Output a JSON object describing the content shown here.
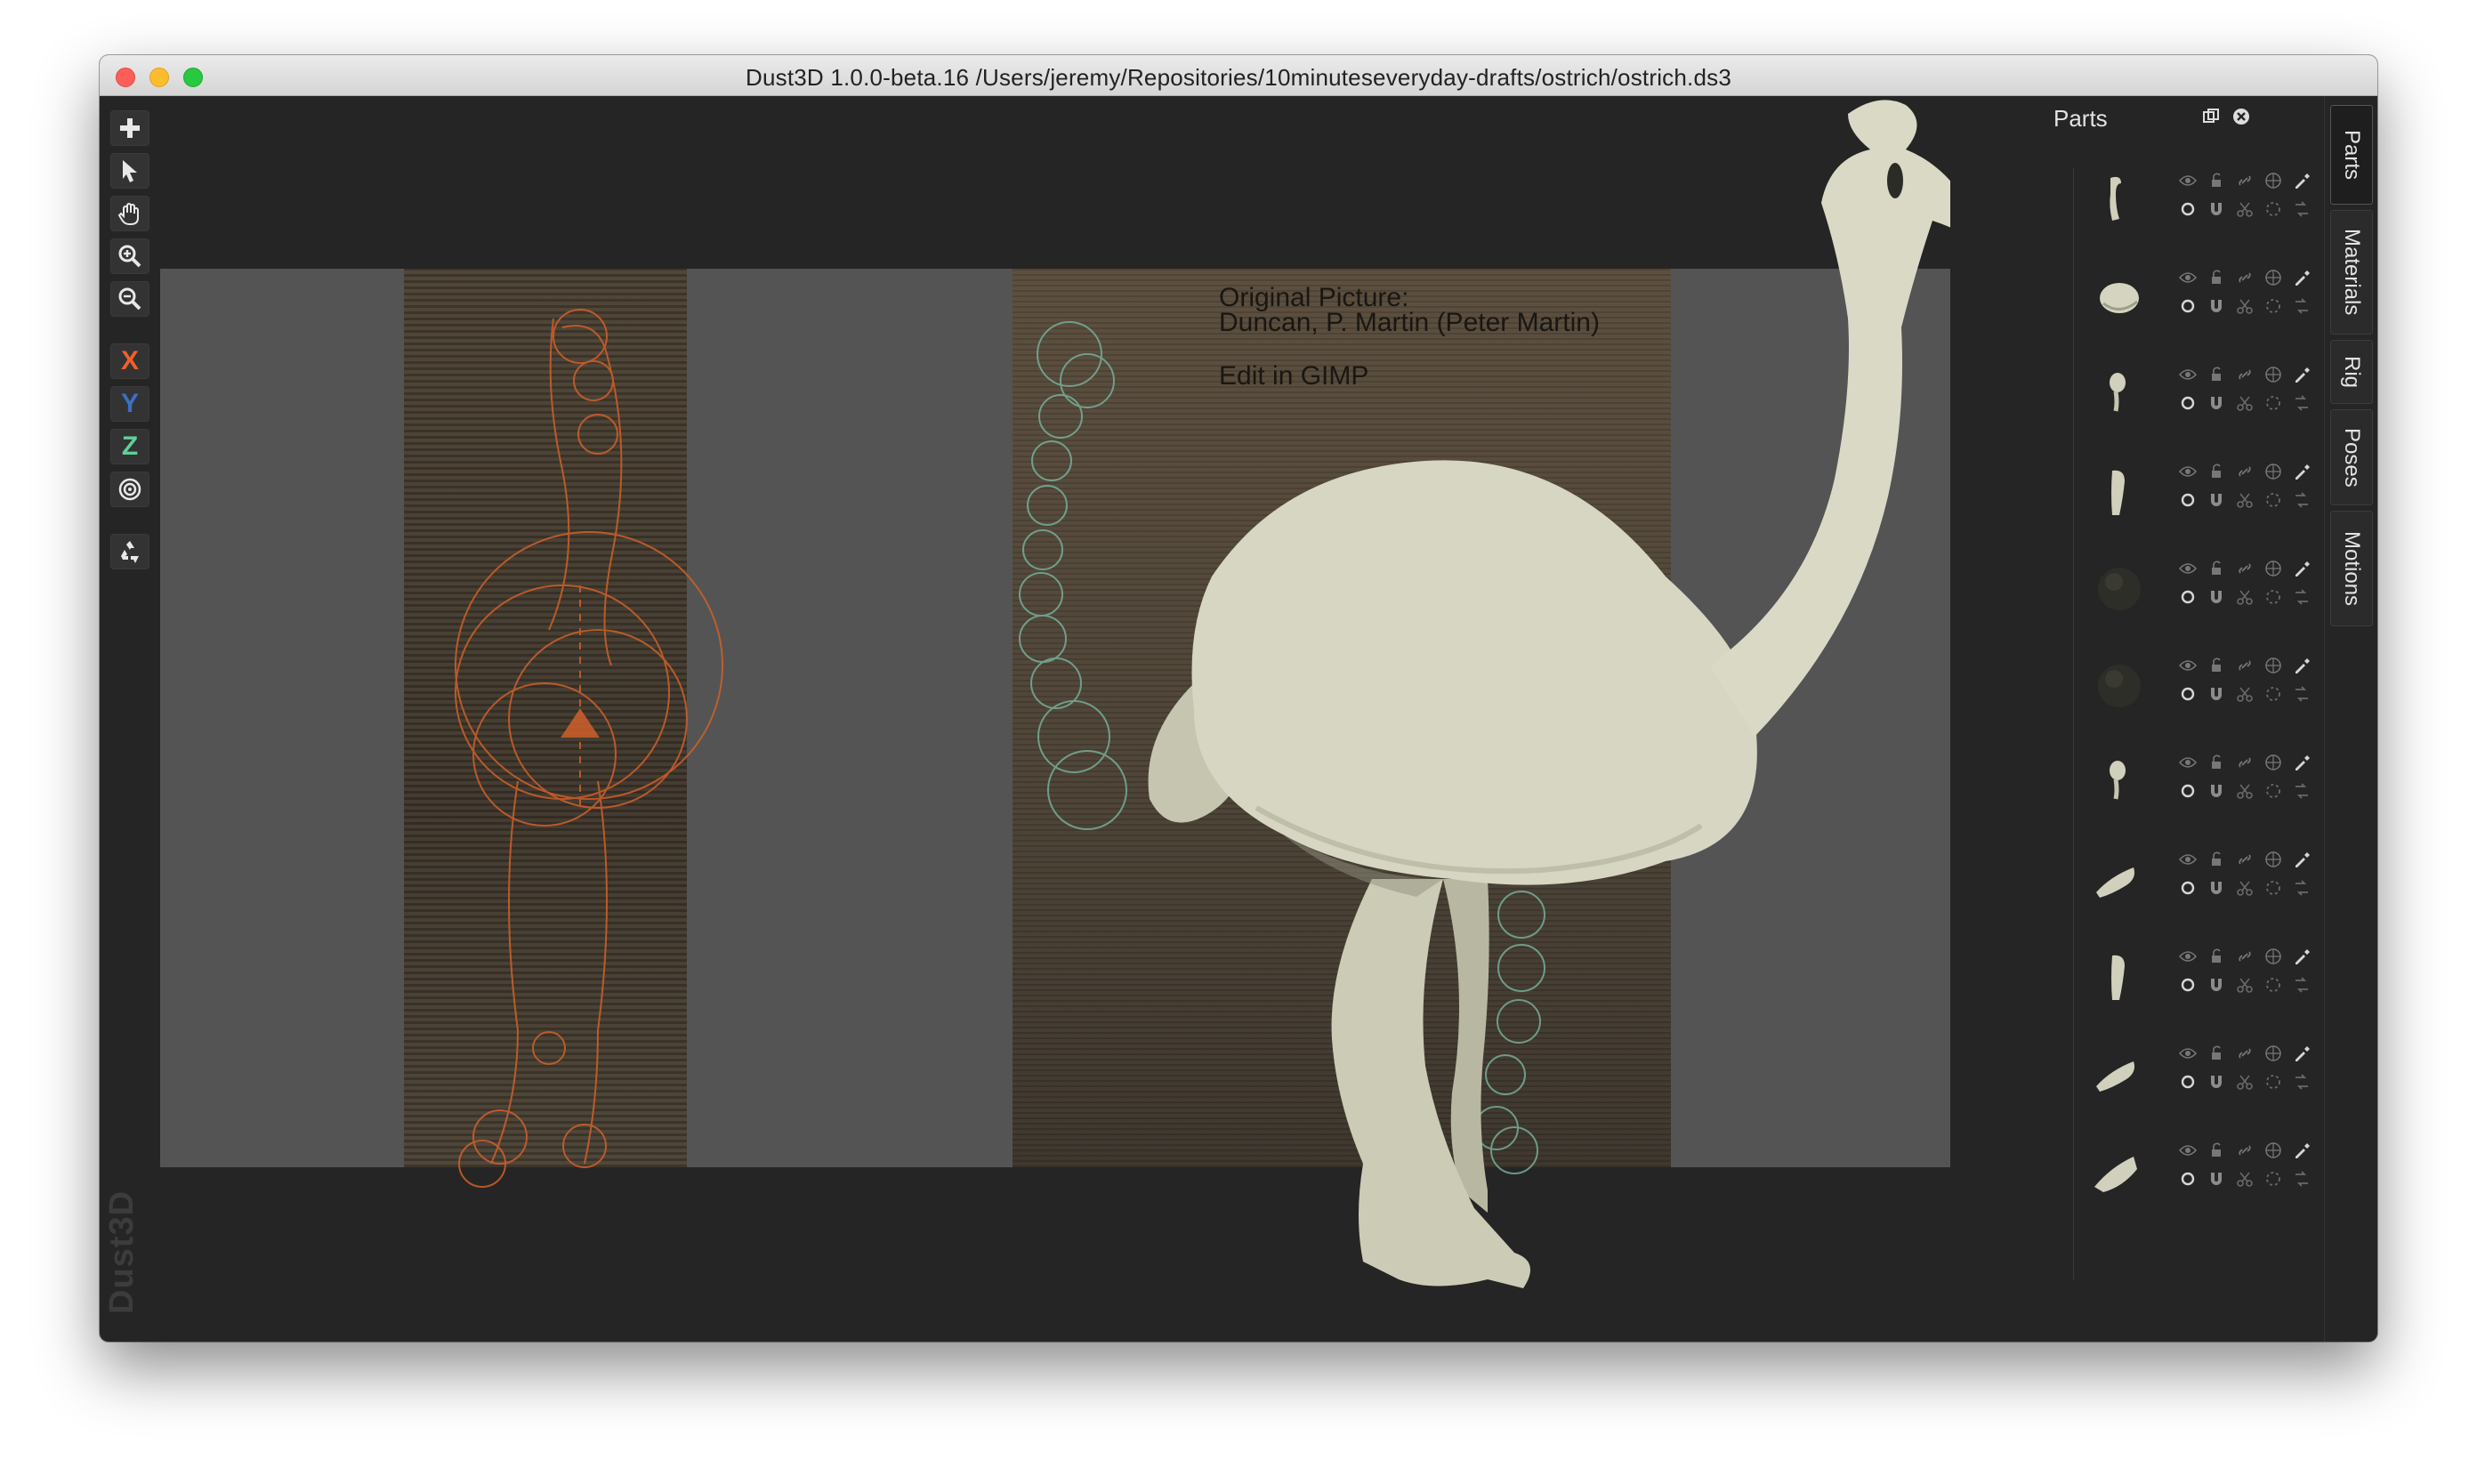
{
  "window": {
    "title": "Dust3D 1.0.0-beta.16 /Users/jeremy/Repositories/10minuteseveryday-drafts/ostrich/ostrich.ds3"
  },
  "toolbar": {
    "add_icon": "plus-icon",
    "select_icon": "cursor-arrow-icon",
    "pan_icon": "hand-icon",
    "zoom_in_icon": "zoom-in-icon",
    "zoom_out_icon": "zoom-out-icon",
    "x_label": "X",
    "y_label": "Y",
    "z_label": "Z",
    "radius_icon": "target-icon",
    "regenerate_icon": "recycle-icon",
    "x_color": "#f0602a",
    "y_color": "#3c6fc6",
    "z_color": "#5fd09a"
  },
  "brand": "Dust3D",
  "reference": {
    "line1": "Original Picture:",
    "line2": "Duncan, P. Martin (Peter Martin)",
    "line3": "Edit in GIMP"
  },
  "parts_panel": {
    "title": "Parts",
    "float_icon": "float-window-icon",
    "close_icon": "close-icon",
    "parts": [
      {
        "shape": "neck-head"
      },
      {
        "shape": "body-blob"
      },
      {
        "shape": "small-head"
      },
      {
        "shape": "leg-upper"
      },
      {
        "shape": "dark-ball"
      },
      {
        "shape": "dark-ball"
      },
      {
        "shape": "small-head"
      },
      {
        "shape": "wing-slim"
      },
      {
        "shape": "leg-upper"
      },
      {
        "shape": "wing-slim"
      },
      {
        "shape": "foot"
      }
    ]
  },
  "tabs": [
    {
      "label": "Parts",
      "active": true
    },
    {
      "label": "Materials",
      "active": false
    },
    {
      "label": "Rig",
      "active": false
    },
    {
      "label": "Poses",
      "active": false
    },
    {
      "label": "Motions",
      "active": false
    }
  ]
}
